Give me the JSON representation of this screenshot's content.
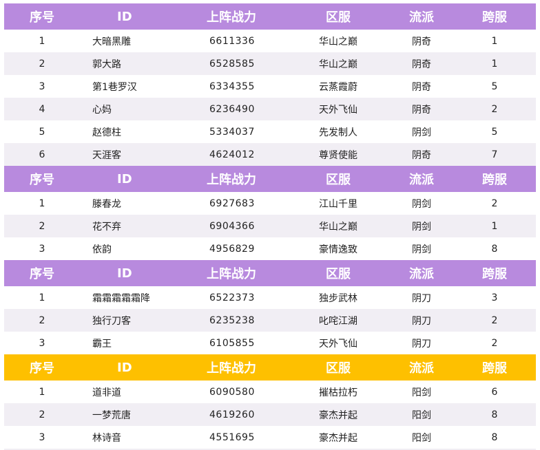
{
  "headers": [
    "序号",
    "ID",
    "上阵战力",
    "区服",
    "流派",
    "跨服"
  ],
  "colors": {
    "header_purple": "#b88ade",
    "header_gold": "#fec000",
    "row_alt": "#f1eef4",
    "text": "#222222",
    "header_text": "#ffffff"
  },
  "groups": [
    {
      "header_color": "#b88ade",
      "rows": [
        [
          "1",
          "大暗黑雕",
          "6611336",
          "华山之巅",
          "阴奇",
          "1"
        ],
        [
          "2",
          "郭大路",
          "6528585",
          "华山之巅",
          "阴奇",
          "1"
        ],
        [
          "3",
          "第1巷罗汉",
          "6334355",
          "云蒸霞蔚",
          "阴奇",
          "5"
        ],
        [
          "4",
          "心妈",
          "6236490",
          "天外飞仙",
          "阴奇",
          "2"
        ],
        [
          "5",
          "赵德柱",
          "5334037",
          "先发制人",
          "阴剑",
          "5"
        ],
        [
          "6",
          "天涯客",
          "4624012",
          "尊贤使能",
          "阴奇",
          "7"
        ]
      ]
    },
    {
      "header_color": "#b88ade",
      "rows": [
        [
          "1",
          "滕春龙",
          "6927683",
          "江山千里",
          "阴剑",
          "2"
        ],
        [
          "2",
          "花不弃",
          "6904366",
          "华山之巅",
          "阴剑",
          "1"
        ],
        [
          "3",
          "依韵",
          "4956829",
          "豪情逸致",
          "阴剑",
          "8"
        ]
      ]
    },
    {
      "header_color": "#b88ade",
      "rows": [
        [
          "1",
          "霜霜霜霜霜降",
          "6522373",
          "独步武林",
          "阴刀",
          "3"
        ],
        [
          "2",
          "独行刀客",
          "6235238",
          "叱咤江湖",
          "阴刀",
          "2"
        ],
        [
          "3",
          "霸王",
          "6105855",
          "天外飞仙",
          "阴刀",
          "2"
        ]
      ]
    },
    {
      "header_color": "#fec000",
      "rows": [
        [
          "1",
          "道非道",
          "6090580",
          "摧枯拉朽",
          "阳剑",
          "6"
        ],
        [
          "2",
          "一梦荒唐",
          "4619260",
          "豪杰并起",
          "阳剑",
          "8"
        ],
        [
          "3",
          "林诗音",
          "4551695",
          "豪杰并起",
          "阳剑",
          "8"
        ]
      ]
    }
  ]
}
